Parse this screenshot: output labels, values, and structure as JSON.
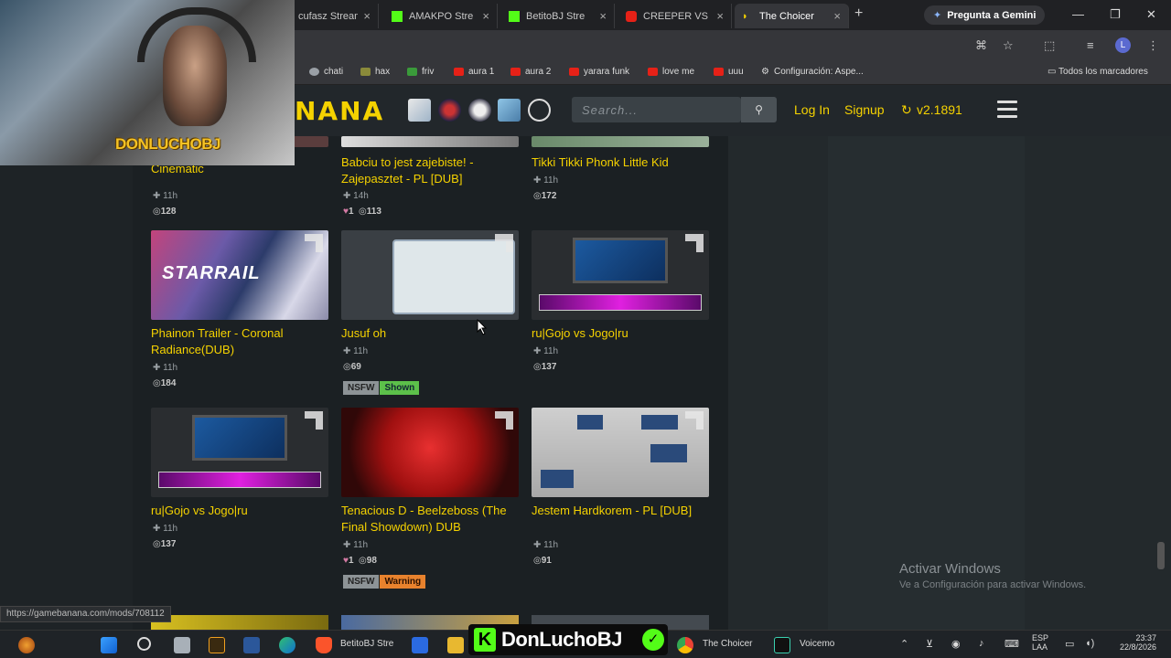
{
  "browser": {
    "tabs": [
      {
        "label": "cufasz Stream",
        "favicon": "kick",
        "active": false
      },
      {
        "label": "AMAKPO Stre",
        "favicon": "kick",
        "active": false
      },
      {
        "label": "BetitoBJ Stre",
        "favicon": "kick",
        "active": false
      },
      {
        "label": "CREEPER VS",
        "favicon": "youtube",
        "active": false
      },
      {
        "label": "The Choicer",
        "favicon": "gamebanana",
        "active": true
      }
    ],
    "new_tab": "+",
    "gemini_label": "Pregunta a Gemini",
    "bookmarks": [
      {
        "label": "chati",
        "color": "#9aa0a6"
      },
      {
        "label": "hax",
        "color": "#8a8a3a"
      },
      {
        "label": "friv",
        "color": "#3a9a3a"
      },
      {
        "label": "aura 1",
        "color": "#e62117"
      },
      {
        "label": "aura 2",
        "color": "#e62117"
      },
      {
        "label": "yarara funk",
        "color": "#e62117"
      },
      {
        "label": "love me",
        "color": "#e62117"
      },
      {
        "label": "uuu",
        "color": "#e62117"
      },
      {
        "label": "Configuración: Aspe...",
        "color": "#9aa0a6"
      }
    ],
    "all_bookmarks": "Todos los marcadores",
    "profile_initial": "L"
  },
  "site": {
    "logo": "NANA",
    "search_placeholder": "Search...",
    "login": "Log In",
    "signup": "Signup",
    "version": "v2.1891",
    "accent": "#f5d200"
  },
  "cards": [
    {
      "title": "...Cinematic",
      "title_full": "Cinematic",
      "time": "11h",
      "likes": "",
      "views": "128",
      "badges": []
    },
    {
      "title": "Babciu to jest zajebiste! - Zajepasztet - PL [DUB]",
      "time": "14h",
      "likes": "1",
      "views": "113",
      "badges": []
    },
    {
      "title": "Tikki Tikki Phonk Little Kid",
      "time": "11h",
      "likes": "",
      "views": "172",
      "badges": []
    },
    {
      "title": "Phainon Trailer - Coronal Radiance(DUB)",
      "time": "11h",
      "likes": "",
      "views": "184",
      "badges": []
    },
    {
      "title": "Jusuf oh",
      "time": "11h",
      "likes": "",
      "views": "69",
      "badges": [
        {
          "label": "NSFW",
          "kind": "nsfw"
        },
        {
          "label": "Shown",
          "kind": "shown"
        }
      ]
    },
    {
      "title": "ru|Gojo vs Jogo|ru",
      "time": "11h",
      "likes": "",
      "views": "137",
      "badges": []
    },
    {
      "title": "ru|Gojo vs Jogo|ru",
      "time": "11h",
      "likes": "",
      "views": "137",
      "badges": []
    },
    {
      "title": "Tenacious D - Beelzeboss (The Final Showdown) DUB",
      "time": "11h",
      "likes": "1",
      "views": "98",
      "badges": [
        {
          "label": "NSFW",
          "kind": "nsfw"
        },
        {
          "label": "Warning",
          "kind": "warn"
        }
      ]
    },
    {
      "title": "Jestem Hardkorem - PL [DUB]",
      "time": "11h",
      "likes": "",
      "views": "91",
      "badges": []
    }
  ],
  "overlay": {
    "activate_title": "Activar Windows",
    "activate_sub": "Ve a Configuración para activar Windows.",
    "status_url": "https://gamebanana.com/mods/708112",
    "webcam_name": "DONLUCHOBJ"
  },
  "taskbar": {
    "items": [
      {
        "label": "BetitoBJ Stre"
      },
      {
        "label": "The Choicer"
      },
      {
        "label": "Voicemo"
      }
    ],
    "banner_name": "DonLuchoBJ",
    "lang_top": "ESP",
    "lang_bottom": "LAA",
    "time": "23:37",
    "date": "22/8/2026"
  }
}
